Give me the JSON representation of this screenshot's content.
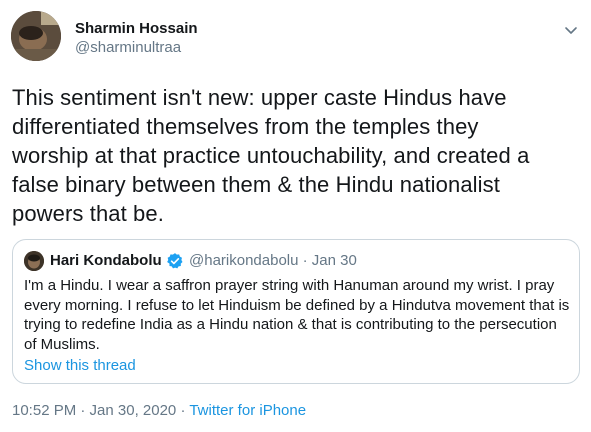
{
  "author": {
    "name": "Sharmin Hossain",
    "handle": "@sharminultraa"
  },
  "tweet": {
    "text": "This sentiment isn't new: upper caste Hindus have\ndifferentiated themselves from the temples they\nworship at that practice untouchability, and created a\nfalse binary between them & the Hindu nationalist\npowers that be."
  },
  "quoted_tweet": {
    "name": "Hari Kondabolu",
    "handle_date": "@harikondabolu · Jan 30",
    "text": "I'm a Hindu. I wear a saffron prayer string with Hanuman around my wrist. I pray every morning. I refuse to let Hinduism be defined by a Hindutva movement that is trying to redefine India as a Hindu nation & that is contributing to the persecution of Muslims.",
    "show_thread": "Show this thread"
  },
  "meta": {
    "timestamp": "10:52 PM · Jan 30, 2020 · ",
    "source": "Twitter for iPhone"
  },
  "icons": {
    "caret": "chevron-down-icon",
    "verified": "verified-badge-icon"
  },
  "colors": {
    "link": "#1b95e0",
    "secondary_text": "#657786",
    "border": "#ccd6dd",
    "verified": "#1da1f2"
  }
}
